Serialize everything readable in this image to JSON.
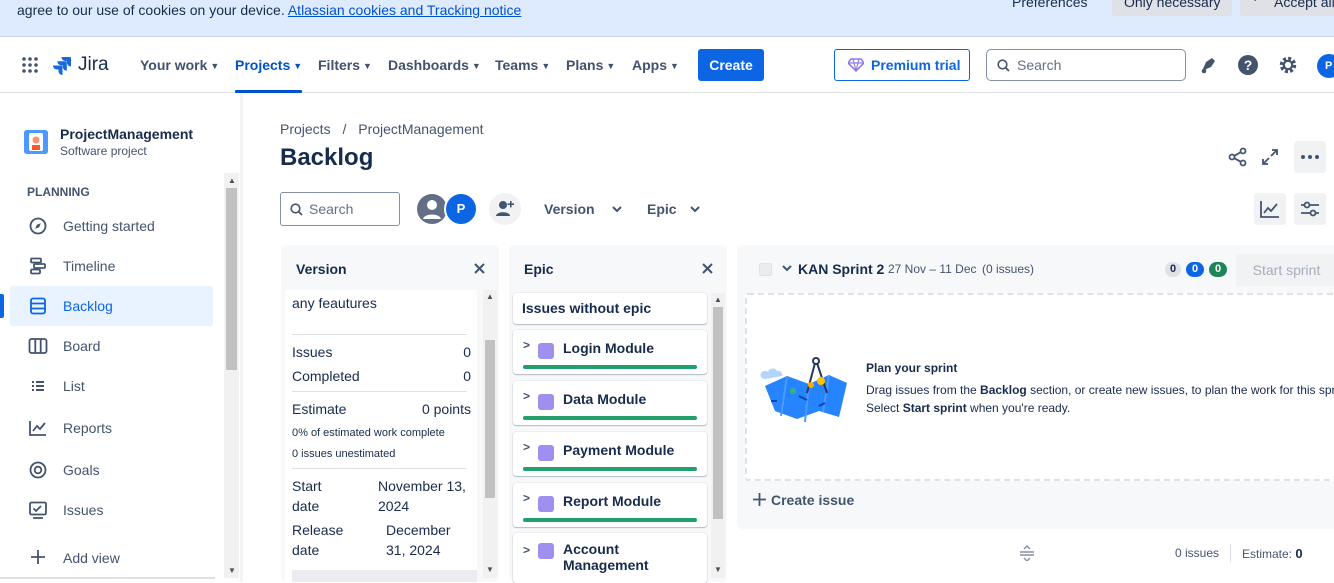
{
  "cookie_banner": {
    "text": "agree to our use of cookies on your device.",
    "link": "Atlassian cookies and Tracking notice",
    "preferences": "Preferences",
    "only_necessary": "Only necessary",
    "accept_all": "Accept all"
  },
  "topnav": {
    "logo": "Jira",
    "items": [
      {
        "label": "Your work"
      },
      {
        "label": "Projects"
      },
      {
        "label": "Filters"
      },
      {
        "label": "Dashboards"
      },
      {
        "label": "Teams"
      },
      {
        "label": "Plans"
      },
      {
        "label": "Apps"
      }
    ],
    "create": "Create",
    "premium": "Premium trial",
    "search_placeholder": "Search",
    "avatar": "P"
  },
  "sidebar": {
    "project_name": "ProjectManagement",
    "project_type": "Software project",
    "section": "PLANNING",
    "items": [
      {
        "label": "Getting started",
        "icon": "compass-icon"
      },
      {
        "label": "Timeline",
        "icon": "timeline-icon"
      },
      {
        "label": "Backlog",
        "icon": "backlog-icon"
      },
      {
        "label": "Board",
        "icon": "board-icon"
      },
      {
        "label": "List",
        "icon": "list-icon"
      },
      {
        "label": "Reports",
        "icon": "reports-icon"
      },
      {
        "label": "Goals",
        "icon": "goals-icon"
      },
      {
        "label": "Issues",
        "icon": "issues-icon"
      }
    ],
    "add_view": "Add view",
    "active_item": "Backlog",
    "accent": "#0c66e4"
  },
  "main": {
    "breadcrumb": {
      "root": "Projects",
      "separator": "/",
      "project": "ProjectManagement"
    },
    "title": "Backlog",
    "search_placeholder": "Search",
    "avatar": "P",
    "version_filter": "Version",
    "epic_filter": "Epic"
  },
  "version_panel": {
    "title": "Version",
    "name_text": "any feautures",
    "issues_label": "Issues",
    "issues_value": "0",
    "completed_label": "Completed",
    "completed_value": "0",
    "estimate_label": "Estimate",
    "estimate_value": "0 points",
    "pct_text": "0% of estimated work complete",
    "unestimated_text": "0 issues unestimated",
    "start_label_1": "Start",
    "start_label_2": "date",
    "start_value_1": "November 13,",
    "start_value_2": "2024",
    "release_label_1": "Release",
    "release_label_2": "date",
    "release_value_1": "December",
    "release_value_2": "31, 2024"
  },
  "epic_panel": {
    "title": "Epic",
    "no_epic": "Issues without epic",
    "epics": [
      {
        "name": "Login Module",
        "color": "#9f8fef"
      },
      {
        "name": "Data Module",
        "color": "#9f8fef"
      },
      {
        "name": "Payment Module",
        "color": "#9f8fef"
      },
      {
        "name": "Report Module",
        "color": "#9f8fef"
      },
      {
        "name": "Account",
        "name_line2": "Management",
        "color": "#9f8fef"
      }
    ]
  },
  "sprint": {
    "name": "KAN Sprint 2",
    "dates": "27 Nov – 11 Dec",
    "issue_count": "(0 issues)",
    "badge_todo": "0",
    "badge_progress": "0",
    "badge_done": "0",
    "start_button": "Start sprint",
    "plan_title": "Plan your sprint",
    "plan_line1_pre": "Drag issues from the ",
    "plan_line1_bold": "Backlog",
    "plan_line1_post": " section, or create new issues, to plan the work for this sprint.",
    "plan_line2_pre": "Select ",
    "plan_line2_bold": "Start sprint",
    "plan_line2_post": " when you're ready.",
    "create_issue": "Create issue",
    "footer_issues": "0 issues",
    "footer_estimate_label": "Estimate:",
    "footer_estimate_value": "0"
  }
}
